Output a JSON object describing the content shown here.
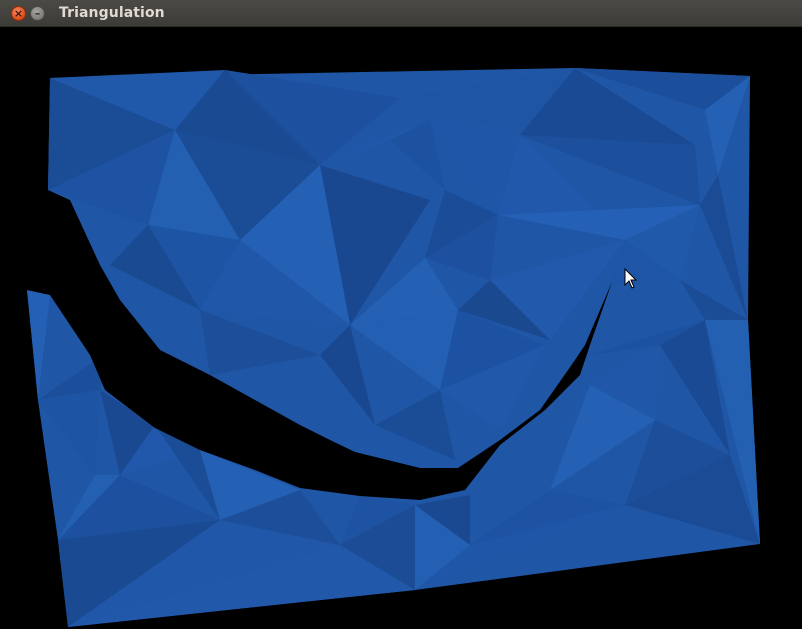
{
  "window": {
    "title": "Triangulation",
    "close_glyph": "×",
    "minimize_glyph": "–"
  },
  "icons": {
    "close": "close-icon",
    "minimize": "minimize-icon",
    "cursor": "arrow-cursor-icon"
  },
  "colors": {
    "background": "#000000",
    "mesh_base": "#1f56a6",
    "mesh_shades": [
      "#1a4c95",
      "#1d52a0",
      "#2059aa",
      "#235db0",
      "#184790",
      "#2460b4"
    ]
  }
}
